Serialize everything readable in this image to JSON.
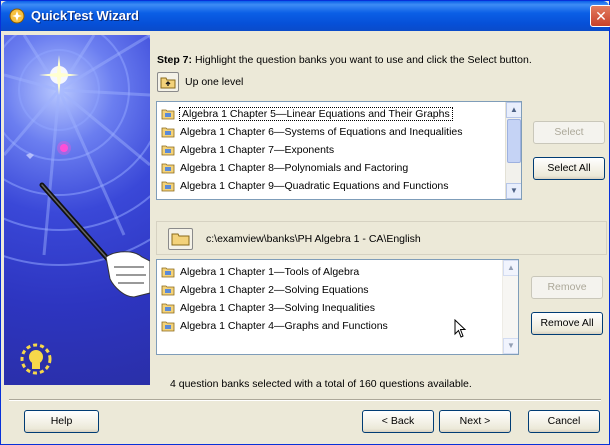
{
  "window": {
    "title": "QuickTest Wizard",
    "accent_color": "#0a5fe8",
    "close_icon": "close-icon"
  },
  "step": {
    "label": "Step 7:",
    "instruction": "Highlight the question banks you want to use and click the Select button."
  },
  "up_one_level": {
    "icon": "folder-up-icon",
    "label": "Up one level"
  },
  "available_banks": {
    "items": [
      "Algebra 1 Chapter 5—Linear Equations and Their Graphs",
      "Algebra 1 Chapter 6—Systems of Equations and Inequalities",
      "Algebra 1 Chapter 7—Exponents",
      "Algebra 1 Chapter 8—Polynomials and Factoring",
      "Algebra 1 Chapter 9—Quadratic Equations and Functions"
    ],
    "focused_index": 0
  },
  "buttons": {
    "select": "Select",
    "select_all": "Select All",
    "remove": "Remove",
    "remove_all": "Remove All",
    "help": "Help",
    "back": "< Back",
    "next": "Next >",
    "cancel": "Cancel"
  },
  "current_path": {
    "icon": "folder-icon",
    "path": "c:\\examview\\banks\\PH Algebra 1 - CA\\English"
  },
  "selected_banks": {
    "items": [
      "Algebra 1 Chapter 1—Tools of Algebra",
      "Algebra 1 Chapter 2—Solving Equations",
      "Algebra 1 Chapter 3—Solving Inequalities",
      "Algebra 1 Chapter 4—Graphs and Functions"
    ]
  },
  "status": {
    "text": "4 question banks selected with a total of 160 questions available."
  }
}
